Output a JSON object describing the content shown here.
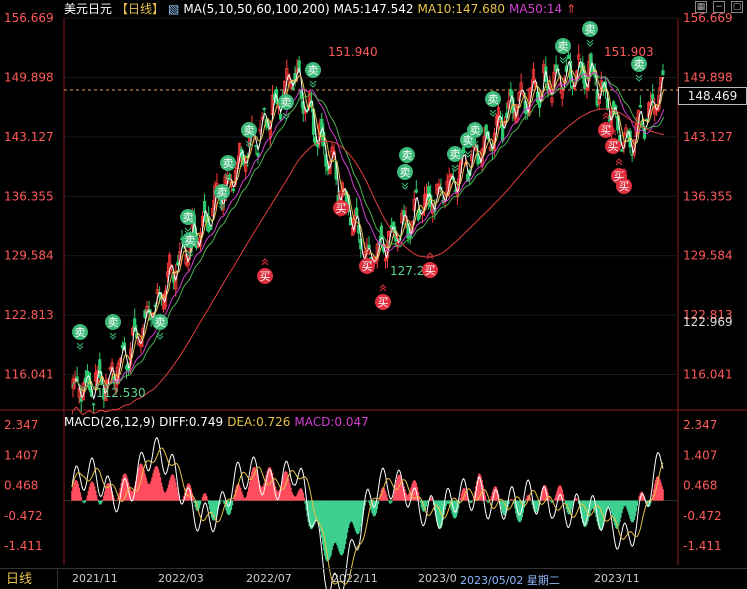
{
  "header": {
    "symbol": "美元日元",
    "period_tag": "【日线】",
    "ma_label": "MA(5,10,50,60,100,200)",
    "ma5": "MA5:147.542",
    "ma10": "MA10:147.680",
    "ma50": "MA50:14"
  },
  "macd_header": {
    "label": "MACD(26,12,9)",
    "diff": "DIFF:0.749",
    "dea": "DEA:0.726",
    "macd": "MACD:0.047"
  },
  "price_axis": {
    "ticks": [
      "156.669",
      "149.898",
      "143.127",
      "136.355",
      "129.584",
      "122.813",
      "116.041"
    ],
    "current_price": "148.469",
    "low_marker": "122.969"
  },
  "macd_axis": {
    "ticks": [
      "2.347",
      "1.407",
      "0.468",
      "-0.472",
      "-1.411"
    ]
  },
  "annotations": {
    "high1": "151.940",
    "high2": "151.903",
    "low1": "112.530",
    "low2": "127.2"
  },
  "bottom": {
    "period_button": "日线",
    "x_labels": [
      "2021/11",
      "2022/03",
      "2022/07",
      "2022/11",
      "2023/0",
      "2023/05/02 星期二",
      "2023/11"
    ]
  },
  "signals": {
    "sell": "卖",
    "buy": "买"
  },
  "colors": {
    "up": "#ff3b3b",
    "down": "#2ecc71",
    "ma5": "#ffffff",
    "ma10": "#e6c34a",
    "ma50": "#d040d0",
    "ma100": "#4caf50",
    "ma200": "#e04040",
    "sell_badge": "#3cb878",
    "buy_badge": "#e0303f"
  },
  "chart_data": [
    {
      "type": "candlestick",
      "title": "美元日元 日线",
      "ylim": [
        112.0,
        156.669
      ],
      "x": [
        "2021/11",
        "2022/01",
        "2022/03",
        "2022/05",
        "2022/07",
        "2022/09",
        "2022/10",
        "2022/11",
        "2023/01",
        "2023/03",
        "2023/05",
        "2023/07",
        "2023/09",
        "2023/10",
        "2023/11",
        "2023/12",
        "2024/01"
      ],
      "close": [
        114.5,
        115.4,
        122.0,
        130.0,
        136.5,
        143.0,
        150.5,
        140.0,
        129.0,
        133.5,
        137.0,
        141.5,
        147.0,
        149.8,
        150.5,
        142.5,
        148.5
      ],
      "series": [
        {
          "name": "MA5",
          "last": 147.542
        },
        {
          "name": "MA10",
          "last": 147.68
        }
      ],
      "annotations": [
        {
          "label": "151.940",
          "x": "2022/10"
        },
        {
          "label": "151.903",
          "x": "2023/11"
        },
        {
          "label": "112.530",
          "x": "2021/11"
        },
        {
          "label": "127.2",
          "x": "2023/01"
        }
      ]
    },
    {
      "type": "bar",
      "title": "MACD(26,12,9)",
      "ylim": [
        -2.0,
        2.347
      ],
      "x": [
        "2021/11",
        "2022/01",
        "2022/03",
        "2022/05",
        "2022/07",
        "2022/09",
        "2022/10",
        "2022/11",
        "2023/01",
        "2023/03",
        "2023/05",
        "2023/07",
        "2023/09",
        "2023/10",
        "2023/11",
        "2023/12",
        "2024/01"
      ],
      "values": [
        0.3,
        0.2,
        0.9,
        0.3,
        -0.4,
        0.8,
        0.5,
        -1.8,
        -0.3,
        0.6,
        -0.6,
        0.5,
        -0.4,
        0.3,
        -0.6,
        -0.5,
        0.6
      ],
      "series": [
        {
          "name": "DIFF",
          "last": 0.749
        },
        {
          "name": "DEA",
          "last": 0.726
        },
        {
          "name": "MACD",
          "last": 0.047
        }
      ]
    }
  ]
}
